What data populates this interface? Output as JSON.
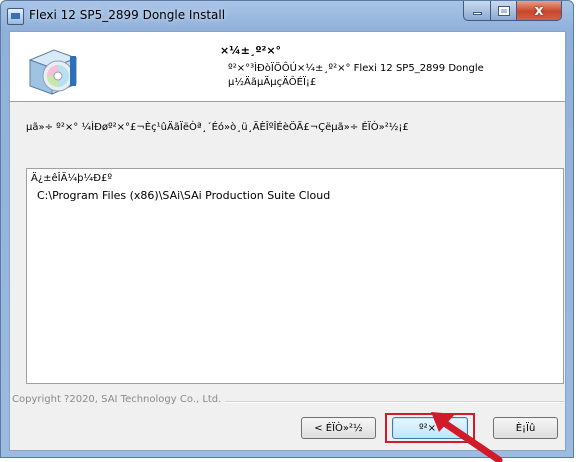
{
  "window": {
    "title": "Flexi 12 SP5_2899 Dongle Install",
    "controls": {
      "minimize_icon": "minimize-icon",
      "maximize_icon": "maximize-icon",
      "close_glyph": "x"
    }
  },
  "header": {
    "title": "×¼±¸º²×°",
    "subtitle_line1": "º²×°³ÌÐòÏÖÔÚ×¼±¸º²×° Flexi 12 SP5_2899 Dongle",
    "subtitle_line2": "µ½ÄãµÄµçÄÔÉÏ¡£"
  },
  "instruction": "µã»÷ º²×° ¼ÌÐøº²×°£¬Èç¹ûÄãÏëÒª¸´Éó»ò¸ü¸ÄÈÎºÎÉèÖÃ£¬Çëµã»÷ ÉÏÒ»²½¡£",
  "info": {
    "label": "Ä¿±êÎÄ¼þ¼Ð£º",
    "path": "C:\\Program Files (x86)\\SAi\\SAi Production Suite Cloud"
  },
  "footer": {
    "copyright": "Copyright ?2020, SAI Technology Co., Ltd."
  },
  "buttons": {
    "back": "< ÉÏÒ»²½",
    "next": "º²×°",
    "cancel": "È¡Ïû"
  },
  "colors": {
    "highlight": "#d11a2a",
    "arrow": "#d11a2a"
  }
}
